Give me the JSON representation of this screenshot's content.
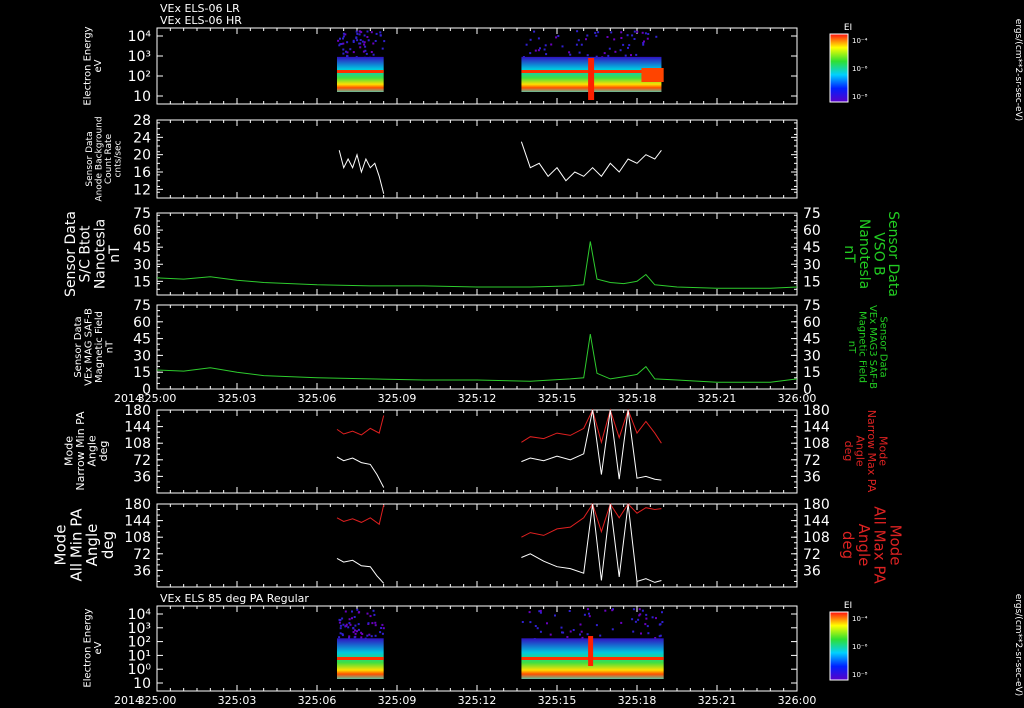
{
  "header": {
    "line1": "VEx ELS-06 LR",
    "line2": "VEx ELS-06 HR",
    "line3": "VEx ELS 85 deg PA Regular"
  },
  "colors": {
    "background": "#000000",
    "frame": "#ffffff",
    "trace_white": "#ffffff",
    "trace_green": "#2ecc2e",
    "trace_red": "#e02020",
    "label_green": "#22cc22",
    "label_red": "#dd2222"
  },
  "time_axis": {
    "year": "2014",
    "ticks": [
      "325:00",
      "325:03",
      "325:06",
      "325:09",
      "325:12",
      "325:15",
      "325:18",
      "325:21",
      "326:00"
    ]
  },
  "colorbar": {
    "title": "EI",
    "ticks": [
      "10⁻⁴",
      "10⁻⁶",
      "10⁻⁸"
    ],
    "unit": "ergs/(cm**2-sr-sec-eV)"
  },
  "chart_data": [
    {
      "type": "heatmap",
      "panel": "spectrogram-top",
      "ylabel": [
        "Electron Energy",
        "eV"
      ],
      "yticks": [
        "10⁴",
        "10³",
        "10²",
        "10"
      ],
      "data_intervals": [
        [
          "325:06:45",
          "325:08:30"
        ],
        [
          "325:13:40",
          "325:18:55"
        ]
      ]
    },
    {
      "type": "line",
      "panel": "anode-background",
      "ylabel": [
        "Sensor Data",
        "Anode Background",
        "Count Rate",
        "cnts/sec"
      ],
      "ylim": [
        10,
        28
      ],
      "yticks": [
        12,
        16,
        20,
        24,
        28
      ],
      "series": [
        {
          "color": "#ffffff",
          "segments": [
            {
              "x": [
                "325:06:50",
                "325:07:00",
                "325:07:10",
                "325:07:20",
                "325:07:30",
                "325:07:40",
                "325:07:50",
                "325:08:00",
                "325:08:10",
                "325:08:20",
                "325:08:30"
              ],
              "y": [
                21,
                17,
                19,
                17,
                20,
                16,
                19,
                17,
                18,
                15,
                11
              ]
            },
            {
              "x": [
                "325:13:40",
                "325:14:00",
                "325:14:20",
                "325:14:40",
                "325:15:00",
                "325:15:20",
                "325:15:40",
                "325:16:00",
                "325:16:20",
                "325:16:40",
                "325:17:00",
                "325:17:20",
                "325:17:40",
                "325:18:00",
                "325:18:20",
                "325:18:40",
                "325:18:55"
              ],
              "y": [
                23,
                17,
                18,
                15,
                17,
                14,
                16,
                15,
                17,
                15,
                18,
                16,
                19,
                18,
                20,
                19,
                21
              ]
            }
          ]
        }
      ]
    },
    {
      "type": "line",
      "panel": "scb-total",
      "ylabel": [
        "Sensor Data",
        "S/C Btot",
        "Nanotesla",
        "nT"
      ],
      "ylabel_right": [
        "Sensor Data",
        "VSO B",
        "Nanotesla",
        "nT"
      ],
      "ylim": [
        3,
        75
      ],
      "yticks": [
        15,
        30,
        45,
        60,
        75
      ],
      "series": [
        {
          "color": "#2ecc2e",
          "segments": [
            {
              "x": [
                "325:00:00",
                "325:01:00",
                "325:02:00",
                "325:03:00",
                "325:04:00",
                "325:06:00",
                "325:08:00",
                "325:10:00",
                "325:12:00",
                "325:14:00",
                "325:15:30",
                "325:16:00",
                "325:16:15",
                "325:16:30",
                "325:17:00",
                "325:17:30",
                "325:18:00",
                "325:18:20",
                "325:18:40",
                "325:19:30",
                "325:21:00",
                "325:23:00",
                "325:24:00"
              ],
              "y": [
                18,
                17,
                19,
                16,
                14,
                12,
                11,
                11,
                10,
                10,
                11,
                12,
                50,
                17,
                14,
                13,
                15,
                21,
                12,
                10,
                9,
                9,
                10
              ]
            }
          ]
        }
      ]
    },
    {
      "type": "line",
      "panel": "mag-saf",
      "ylabel": [
        "Sensor Data",
        "VEx MAG SAF-B",
        "Magnetic Field",
        "nT"
      ],
      "ylabel_right": [
        "Sensor Data",
        "VEx MAG3 SAF-B",
        "Magnetic Field",
        "nT"
      ],
      "ylim": [
        0,
        75
      ],
      "yticks": [
        0,
        15,
        30,
        45,
        60,
        75
      ],
      "series": [
        {
          "color": "#2ecc2e",
          "segments": [
            {
              "x": [
                "325:00:00",
                "325:01:00",
                "325:02:00",
                "325:03:00",
                "325:04:00",
                "325:06:00",
                "325:08:00",
                "325:10:00",
                "325:12:00",
                "325:14:00",
                "325:15:30",
                "325:16:00",
                "325:16:15",
                "325:16:30",
                "325:17:00",
                "325:17:30",
                "325:18:00",
                "325:18:20",
                "325:18:40",
                "325:19:30",
                "325:21:00",
                "325:23:00",
                "325:24:00"
              ],
              "y": [
                17,
                16,
                19,
                15,
                12,
                10,
                9,
                8,
                8,
                7,
                9,
                10,
                49,
                14,
                9,
                11,
                13,
                20,
                9,
                8,
                6,
                6,
                9
              ]
            }
          ]
        }
      ]
    },
    {
      "type": "line",
      "panel": "narrow-pa",
      "ylabel": [
        "Mode",
        "Narrow Min PA",
        "Angle",
        "deg"
      ],
      "ylabel_right": [
        "Mode",
        "Narrow Max PA",
        "Angle",
        "deg"
      ],
      "ylim": [
        0,
        180
      ],
      "yticks": [
        36,
        72,
        108,
        144,
        180
      ],
      "series": [
        {
          "color": "#e02020",
          "segments": [
            {
              "x": [
                "325:06:45",
                "325:07:00",
                "325:07:20",
                "325:07:40",
                "325:08:00",
                "325:08:20",
                "325:08:30"
              ],
              "y": [
                138,
                128,
                134,
                126,
                140,
                130,
                168
              ]
            },
            {
              "x": [
                "325:13:40",
                "325:14:00",
                "325:14:30",
                "325:15:00",
                "325:15:30",
                "325:16:00",
                "325:16:20",
                "325:16:40",
                "325:17:00",
                "325:17:20",
                "325:17:40",
                "325:18:00",
                "325:18:20",
                "325:18:40",
                "325:18:55"
              ],
              "y": [
                110,
                122,
                118,
                130,
                125,
                140,
                180,
                110,
                180,
                120,
                180,
                130,
                155,
                130,
                108
              ]
            }
          ]
        },
        {
          "color": "#ffffff",
          "segments": [
            {
              "x": [
                "325:06:45",
                "325:07:00",
                "325:07:20",
                "325:07:40",
                "325:08:00",
                "325:08:15",
                "325:08:30"
              ],
              "y": [
                78,
                70,
                76,
                66,
                62,
                40,
                12
              ]
            },
            {
              "x": [
                "325:13:40",
                "325:14:00",
                "325:14:30",
                "325:15:00",
                "325:15:30",
                "325:16:00",
                "325:16:20",
                "325:16:40",
                "325:17:00",
                "325:17:20",
                "325:17:40",
                "325:18:00",
                "325:18:20",
                "325:18:40",
                "325:18:55"
              ],
              "y": [
                68,
                76,
                70,
                80,
                72,
                85,
                180,
                40,
                180,
                30,
                180,
                32,
                36,
                30,
                28
              ]
            }
          ]
        }
      ]
    },
    {
      "type": "line",
      "panel": "all-pa",
      "ylabel": [
        "Mode",
        "All Min PA",
        "Angle",
        "deg"
      ],
      "ylabel_right": [
        "Mode",
        "All Max PA",
        "Angle",
        "deg"
      ],
      "ylim": [
        0,
        180
      ],
      "yticks": [
        36,
        72,
        108,
        144,
        180
      ],
      "series": [
        {
          "color": "#e02020",
          "segments": [
            {
              "x": [
                "325:06:45",
                "325:07:00",
                "325:07:20",
                "325:07:40",
                "325:08:00",
                "325:08:20",
                "325:08:30"
              ],
              "y": [
                150,
                142,
                148,
                140,
                150,
                136,
                178
              ]
            },
            {
              "x": [
                "325:13:40",
                "325:14:00",
                "325:14:30",
                "325:15:00",
                "325:15:30",
                "325:16:00",
                "325:16:20",
                "325:16:40",
                "325:17:00",
                "325:17:20",
                "325:17:40",
                "325:18:00",
                "325:18:20",
                "325:18:40",
                "325:18:55"
              ],
              "y": [
                108,
                118,
                112,
                126,
                130,
                150,
                180,
                120,
                180,
                150,
                180,
                160,
                172,
                168,
                170
              ]
            }
          ]
        },
        {
          "color": "#ffffff",
          "segments": [
            {
              "x": [
                "325:06:45",
                "325:07:00",
                "325:07:20",
                "325:07:40",
                "325:08:00",
                "325:08:15",
                "325:08:30"
              ],
              "y": [
                62,
                54,
                58,
                46,
                44,
                24,
                8
              ]
            },
            {
              "x": [
                "325:13:40",
                "325:14:00",
                "325:14:30",
                "325:15:00",
                "325:15:30",
                "325:16:00",
                "325:16:20",
                "325:16:40",
                "325:17:00",
                "325:17:20",
                "325:17:40",
                "325:18:00",
                "325:18:20",
                "325:18:40",
                "325:18:55"
              ],
              "y": [
                64,
                72,
                56,
                44,
                40,
                30,
                180,
                14,
                180,
                22,
                180,
                12,
                18,
                10,
                14
              ]
            }
          ]
        }
      ]
    },
    {
      "type": "heatmap",
      "panel": "spectrogram-bottom",
      "ylabel": [
        "Electron Energy",
        "eV"
      ],
      "yticks": [
        "10⁴",
        "10³",
        "10²",
        "10¹",
        "10⁰",
        "10"
      ],
      "data_intervals": [
        [
          "325:06:45",
          "325:08:30"
        ],
        [
          "325:13:40",
          "325:19:00"
        ]
      ]
    }
  ]
}
